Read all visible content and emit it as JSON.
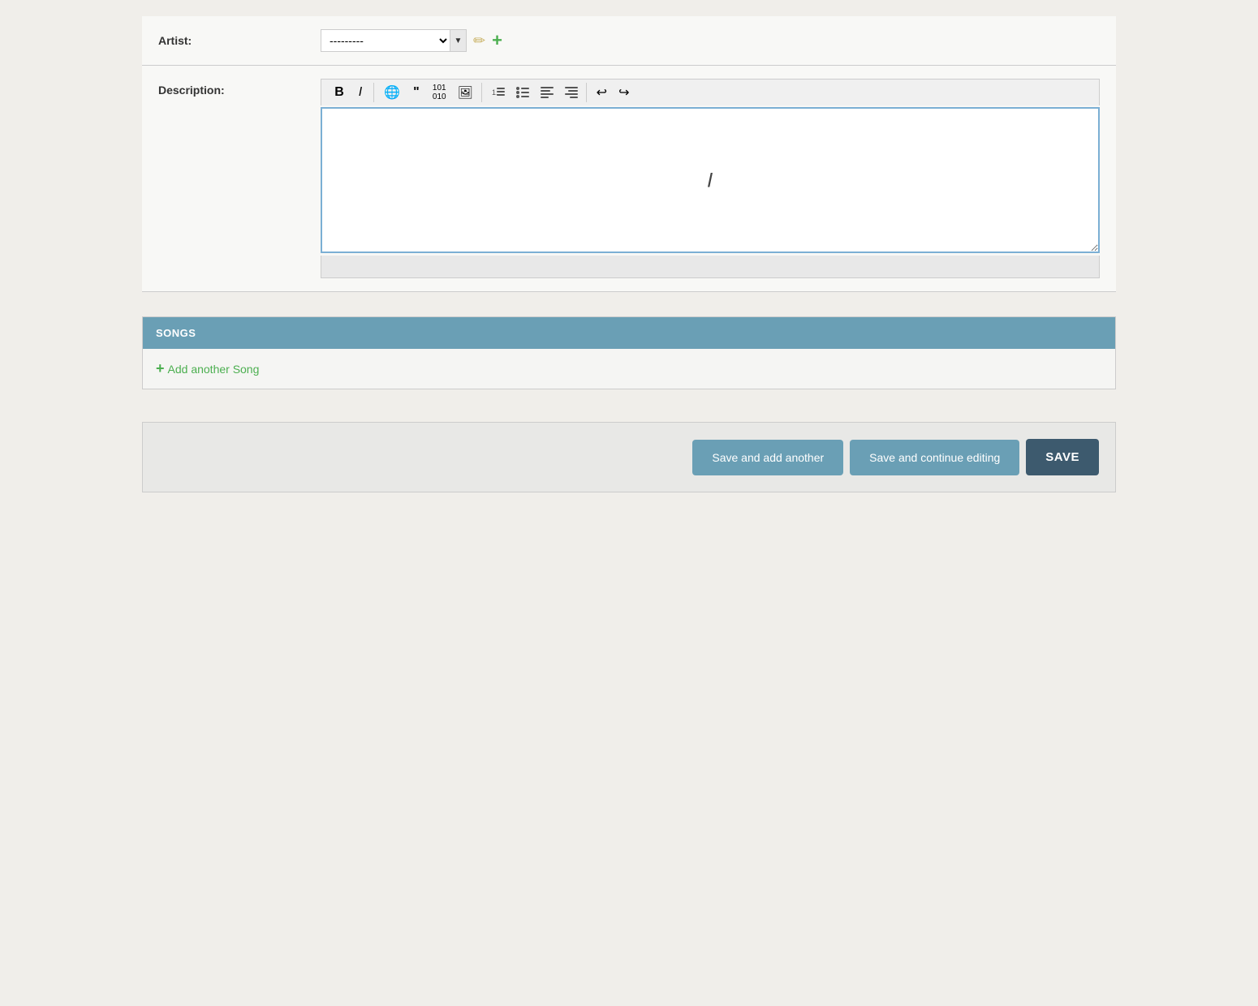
{
  "form": {
    "artist": {
      "label": "Artist:",
      "select_value": "---------",
      "select_placeholder": "---------"
    },
    "description": {
      "label": "Description:",
      "editor_content": ""
    }
  },
  "toolbar": {
    "bold_label": "B",
    "italic_label": "I",
    "globe_icon": "🌐",
    "blockquote_icon": "❝",
    "code_icon": "101\n010",
    "image_icon": "🖼",
    "ol_icon": "≡",
    "ul_icon": "≡",
    "align_left_icon": "≡",
    "align_right_icon": "≡",
    "undo_icon": "↩",
    "redo_icon": "↪"
  },
  "songs_section": {
    "header": "SONGS",
    "add_label": "Add another Song"
  },
  "actions": {
    "save_add_label": "Save and add another",
    "save_continue_label": "Save and continue editing",
    "save_label": "SAVE"
  },
  "icons": {
    "pencil": "✏",
    "plus": "+",
    "arrow_down": "▼",
    "cursor": "I"
  }
}
